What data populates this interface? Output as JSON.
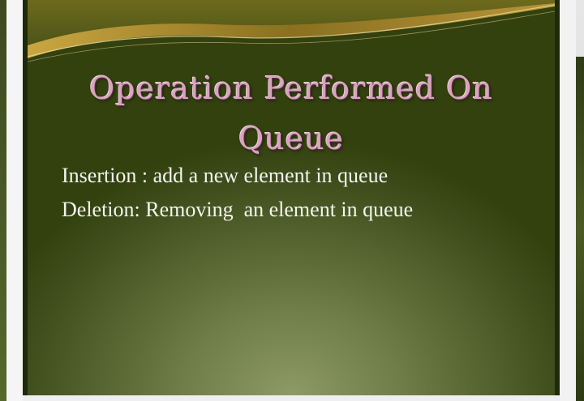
{
  "slide": {
    "title_line1": "Operation Performed On",
    "title_line2": "Queue",
    "bullets": [
      "Insertion : add a new element in queue",
      "Deletion: Removing  an element in queue"
    ]
  },
  "colors": {
    "slide_background": "#566531",
    "title_color": "#d9a3be",
    "body_text": "#f4f4ee",
    "swoosh_gold": "#a9892a"
  }
}
